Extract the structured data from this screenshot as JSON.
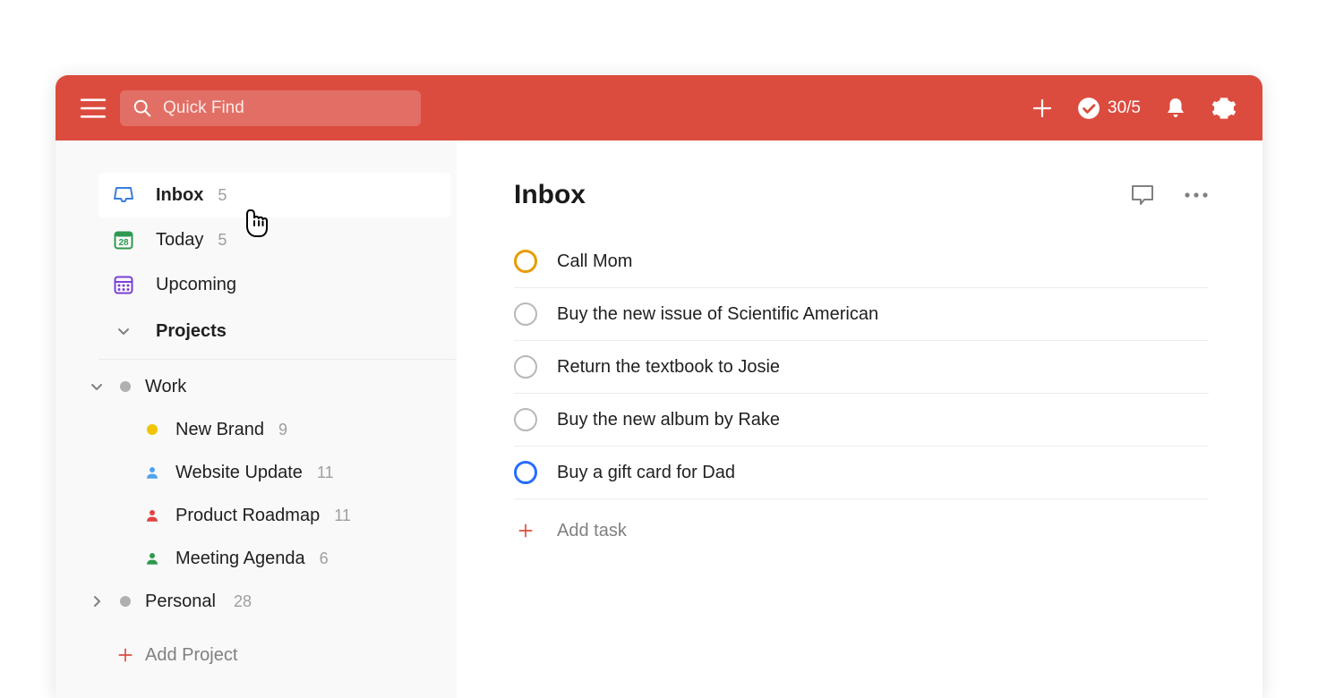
{
  "header": {
    "search_placeholder": "Quick Find",
    "productivity": "30/5"
  },
  "sidebar": {
    "nav": [
      {
        "label": "Inbox",
        "count": "5"
      },
      {
        "label": "Today",
        "count": "5",
        "day": "28"
      },
      {
        "label": "Upcoming",
        "count": ""
      }
    ],
    "projects_label": "Projects",
    "groups": [
      {
        "label": "Work",
        "count": "",
        "expanded": true,
        "items": [
          {
            "label": "New Brand",
            "count": "9"
          },
          {
            "label": "Website Update",
            "count": "11"
          },
          {
            "label": "Product Roadmap",
            "count": "11"
          },
          {
            "label": "Meeting Agenda",
            "count": "6"
          }
        ]
      },
      {
        "label": "Personal",
        "count": "28",
        "expanded": false,
        "items": []
      }
    ],
    "add_project": "Add Project"
  },
  "main": {
    "title": "Inbox",
    "tasks": [
      {
        "title": "Call Mom",
        "priority": "orange"
      },
      {
        "title": "Buy the new issue of Scientific American",
        "priority": ""
      },
      {
        "title": "Return the textbook to Josie",
        "priority": ""
      },
      {
        "title": "Buy the new album by Rake",
        "priority": ""
      },
      {
        "title": "Buy a gift card for Dad",
        "priority": "blue"
      }
    ],
    "add_task": "Add task"
  }
}
